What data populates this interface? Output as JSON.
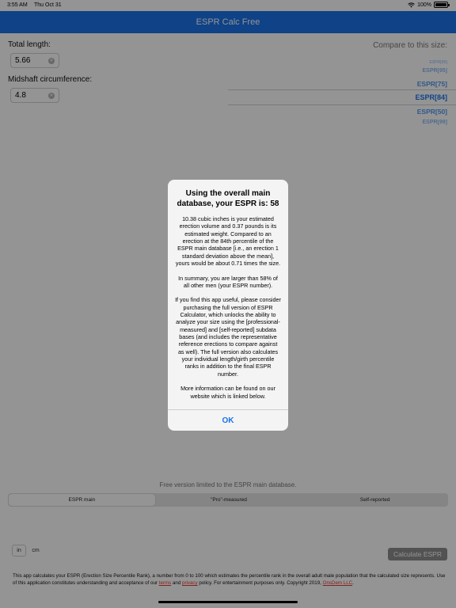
{
  "status_bar": {
    "time": "3:55 AM",
    "date": "Thu Oct 31",
    "battery": "100%"
  },
  "nav": {
    "title": "ESPR Calc Free"
  },
  "inputs": {
    "total_length_label": "Total length:",
    "total_length_value": "5.66",
    "circumference_label": "Midshaft circumference:",
    "circumference_value": "4.8"
  },
  "compare": {
    "title": "Compare to this size:",
    "items": [
      "ESPR[99]",
      "ESPR[95]",
      "ESPR[75]",
      "ESPR[84]",
      "ESPR[50]",
      "ESPR[99]"
    ]
  },
  "limit_note": "Free version limited to the ESPR main database.",
  "database_segments": [
    "ESPR main",
    "\"Pro\"-measured",
    "Self-reported"
  ],
  "units": [
    "in",
    "cm"
  ],
  "calculate_button": "Calculate ESPR",
  "footer": {
    "text_1": "This app calculates your ESPR (Erection Size Percentile Rank), a number from 0 to 100 which estimates the percentile rank in the overall adult male population that the calculated size represents.  Use of this application constitutes understanding and acceptance of our",
    "terms": "terms",
    "and": "and",
    "privacy": "privacy",
    "text_2": "policy.  For entertainment purposes only.  Copyright 2019,",
    "company": "OnsDem LLC",
    "end": "."
  },
  "alert": {
    "title": "Using the overall main database, your ESPR is: 58",
    "paragraph_1": "10.38 cubic inches is your estimated erection volume and 0.37 pounds is its estimated weight.  Compared to an erection at the 84th percentile of the ESPR main database [i.e., an erection 1 standard deviation above the mean], yours would be about 0.71 times the size.",
    "paragraph_2": "In summary, you are larger than 58% of all other men (your ESPR number).",
    "paragraph_3": "If you find this app useful, please consider purchasing the full version of ESPR Calculator, which unlocks the ability to analyze your size using the [professional-measured] and [self-reported] subdata bases (and includes the representative reference erections to compare against as well).  The full version also calculates your individual length/girth percentile ranks in addition to the final ESPR number.",
    "paragraph_4": "More information can be found on our website which is linked below.",
    "ok_label": "OK"
  },
  "colors": {
    "accent": "#1a73e8",
    "link": "#e53935"
  }
}
